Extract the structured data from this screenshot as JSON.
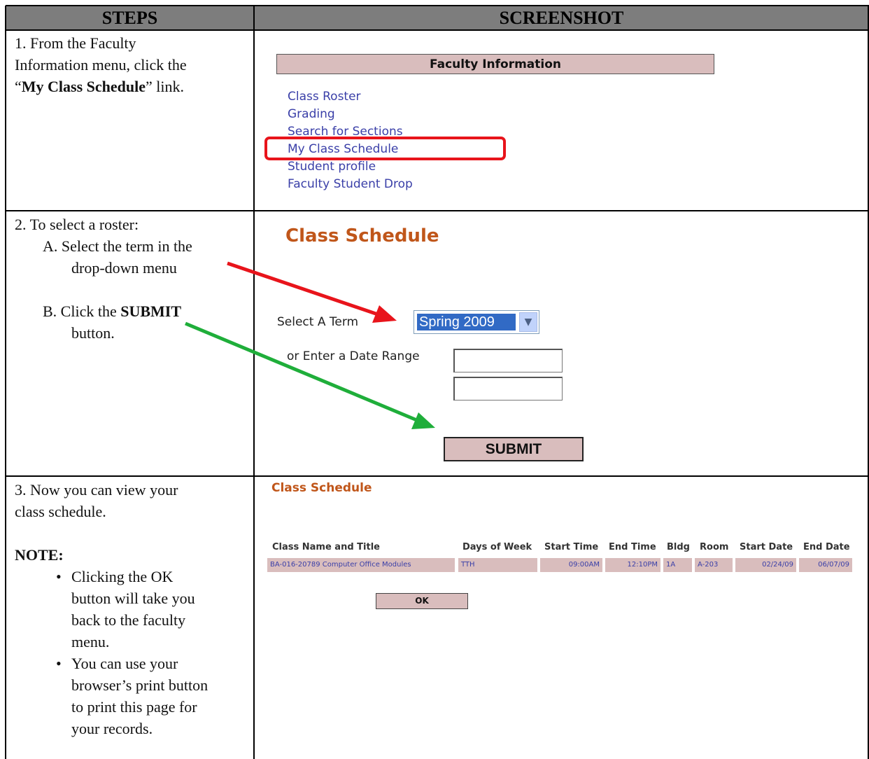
{
  "header": {
    "steps": "STEPS",
    "screenshot": "SCREENSHOT"
  },
  "step1": {
    "l1": "1.  From the Faculty",
    "l2": "Information menu, click the",
    "l3_q1": "“",
    "l3_bold": "My Class Schedule",
    "l3_rest": "” link."
  },
  "step2": {
    "l1": "2.  To select a roster:",
    "a1": "A.  Select the term in the",
    "a2": "drop-down menu",
    "b1_pre": "B.  Click the ",
    "b1_bold": "SUBMIT",
    "b2": "button."
  },
  "step3": {
    "l1": "3.  Now you can view your",
    "l2": "class schedule.",
    "note": "NOTE:",
    "bullet": "•",
    "b1": [
      "Clicking the OK",
      "button will take you",
      "back to the faculty",
      "menu."
    ],
    "b2": [
      "You can use your",
      "browser’s print button",
      "to print this page for",
      "your records."
    ]
  },
  "faculty_menu": {
    "title": "Faculty Information",
    "links": [
      "Class Roster",
      "Grading",
      "Search for Sections",
      "My Class Schedule",
      "Student profile",
      "Faculty Student Drop"
    ]
  },
  "term_form": {
    "title": "Class Schedule",
    "select_label": "Select A Term",
    "term_value": "Spring 2009",
    "date_label": "or Enter a Date Range",
    "submit": "SUBMIT"
  },
  "schedule": {
    "title": "Class Schedule",
    "columns": [
      "Class Name and Title",
      "Days of Week",
      "Start Time",
      "End Time",
      "Bldg",
      "Room",
      "Start Date",
      "End Date"
    ],
    "row": [
      "BA-016-20789 Computer Office Modules",
      "TTH",
      "09:00AM",
      "12:10PM",
      "1A",
      "A-203",
      "02/24/09",
      "06/07/09"
    ],
    "ok": "OK"
  },
  "colors": {
    "highlight_box": "#e8141b",
    "arrow_red": "#e8141b",
    "arrow_green": "#1fae3a",
    "accent": "#c0561a",
    "row_bg": "#d9bdbd"
  }
}
